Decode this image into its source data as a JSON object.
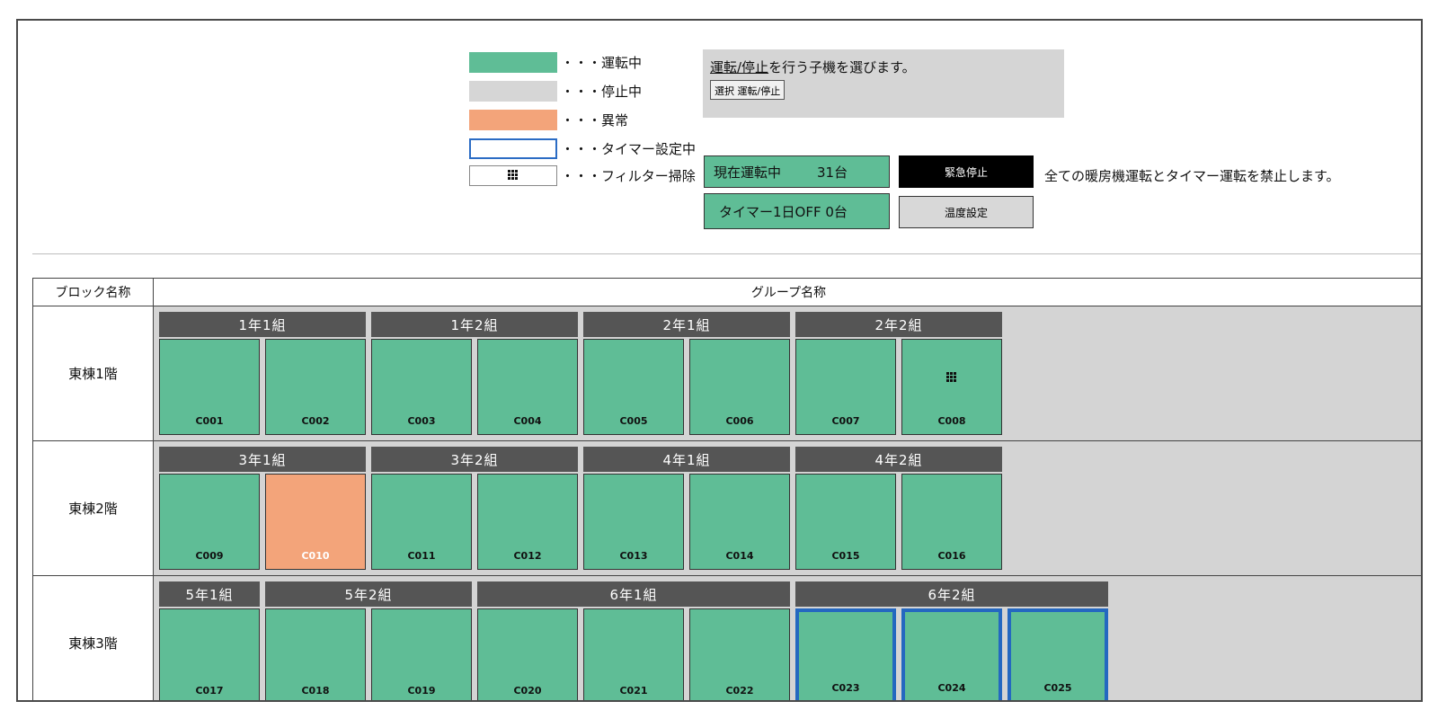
{
  "legend": [
    {
      "swatch": "running",
      "label": "・・・運転中"
    },
    {
      "swatch": "stopped",
      "label": "・・・停止中"
    },
    {
      "swatch": "error",
      "label": "・・・異常"
    },
    {
      "swatch": "timer",
      "label": "・・・タイマー設定中"
    },
    {
      "swatch": "filter",
      "label": "・・・フィルター掃除"
    }
  ],
  "instruction": {
    "text_underlined": "運転/停止",
    "text_rest": "を行う子機を選びます。",
    "button_label": "選択 運転/停止"
  },
  "status": {
    "running_label": "現在運転中",
    "running_count": "31台",
    "timer_off_label": "タイマー1日OFF 0台"
  },
  "actions": {
    "emergency_stop": "緊急停止",
    "temperature_setting": "温度設定",
    "prohibit_note": "全ての暖房機運転とタイマー運転を禁止します。"
  },
  "table": {
    "block_header": "ブロック名称",
    "group_header": "グループ名称",
    "floors": [
      {
        "name": "東棟1階",
        "groups": [
          {
            "name": "1年1組",
            "units": [
              {
                "id": "C001",
                "state": "running"
              },
              {
                "id": "C002",
                "state": "running"
              }
            ]
          },
          {
            "name": "1年2組",
            "units": [
              {
                "id": "C003",
                "state": "running"
              },
              {
                "id": "C004",
                "state": "running"
              }
            ]
          },
          {
            "name": "2年1組",
            "units": [
              {
                "id": "C005",
                "state": "running"
              },
              {
                "id": "C006",
                "state": "running"
              }
            ]
          },
          {
            "name": "2年2組",
            "units": [
              {
                "id": "C007",
                "state": "running"
              },
              {
                "id": "C008",
                "state": "running",
                "filter": true
              }
            ]
          }
        ]
      },
      {
        "name": "東棟2階",
        "groups": [
          {
            "name": "3年1組",
            "units": [
              {
                "id": "C009",
                "state": "running"
              },
              {
                "id": "C010",
                "state": "error"
              }
            ]
          },
          {
            "name": "3年2組",
            "units": [
              {
                "id": "C011",
                "state": "running"
              },
              {
                "id": "C012",
                "state": "running"
              }
            ]
          },
          {
            "name": "4年1組",
            "units": [
              {
                "id": "C013",
                "state": "running"
              },
              {
                "id": "C014",
                "state": "running"
              }
            ]
          },
          {
            "name": "4年2組",
            "units": [
              {
                "id": "C015",
                "state": "running"
              },
              {
                "id": "C016",
                "state": "running"
              }
            ]
          }
        ]
      },
      {
        "name": "東棟3階",
        "groups": [
          {
            "name": "5年1組",
            "units": [
              {
                "id": "C017",
                "state": "running"
              }
            ]
          },
          {
            "name": "5年2組",
            "units": [
              {
                "id": "C018",
                "state": "running"
              },
              {
                "id": "C019",
                "state": "running"
              }
            ]
          },
          {
            "name": "6年1組",
            "units": [
              {
                "id": "C020",
                "state": "running"
              },
              {
                "id": "C021",
                "state": "running"
              },
              {
                "id": "C022",
                "state": "running"
              }
            ]
          },
          {
            "name": "6年2組",
            "units": [
              {
                "id": "C023",
                "state": "running",
                "timer": true
              },
              {
                "id": "C024",
                "state": "running",
                "timer": true
              },
              {
                "id": "C025",
                "state": "running",
                "timer": true
              }
            ]
          }
        ]
      }
    ]
  },
  "colors": {
    "running": "#5fbd96",
    "stopped": "#d6d6d6",
    "error": "#f3a47a",
    "timer_border": "#2468c0",
    "group_header": "#555555"
  }
}
